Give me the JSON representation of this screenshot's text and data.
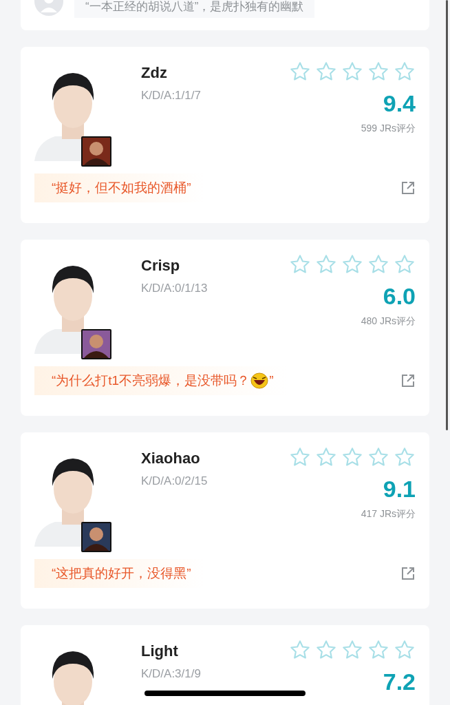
{
  "top_card": {
    "quote": "“一本正经的胡说八道”，是虎扑独有的幽默"
  },
  "players": [
    {
      "name": "Zdz",
      "kda": "K/D/A:1/1/7",
      "stars": 0,
      "score": "9.4",
      "count": "599 JRs评分",
      "quote": "“挺好，但不如我的酒桶”",
      "emoji": false
    },
    {
      "name": "Crisp",
      "kda": "K/D/A:0/1/13",
      "stars": 0,
      "score": "6.0",
      "count": "480 JRs评分",
      "quote": "“为什么打t1不亮弱爆，是没带吗？",
      "emoji": true,
      "quote_end": "”"
    },
    {
      "name": "Xiaohao",
      "kda": "K/D/A:0/2/15",
      "stars": 0,
      "score": "9.1",
      "count": "417 JRs评分",
      "quote": "“这把真的好开，没得黑”",
      "emoji": false
    },
    {
      "name": "Light",
      "kda": "K/D/A:3/1/9",
      "stars": 0,
      "score": "7.2"
    }
  ]
}
